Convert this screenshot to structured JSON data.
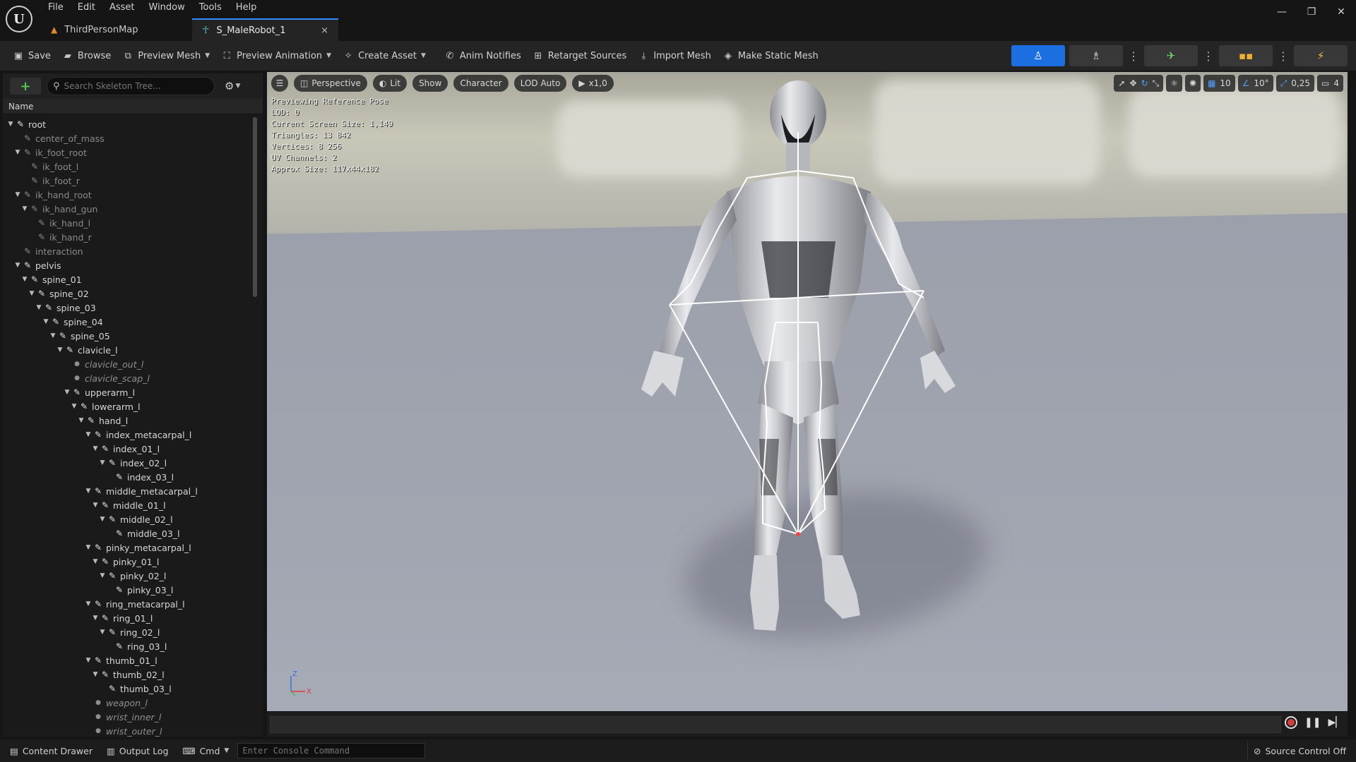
{
  "menu": [
    "File",
    "Edit",
    "Asset",
    "Window",
    "Tools",
    "Help"
  ],
  "tabs": [
    {
      "label": "ThirdPersonMap",
      "icon": "map-icon"
    },
    {
      "label": "S_MaleRobot_1",
      "icon": "skeleton-icon",
      "active": true,
      "close": "×"
    }
  ],
  "window_controls": {
    "minimize": "—",
    "restore": "❐",
    "close": "✕"
  },
  "toolbar": {
    "save": "Save",
    "browse": "Browse",
    "preview_mesh": "Preview Mesh",
    "preview_animation": "Preview Animation",
    "create_asset": "Create Asset",
    "anim_notifies": "Anim Notifies",
    "retarget_sources": "Retarget Sources",
    "import_mesh": "Import Mesh",
    "make_static_mesh": "Make Static Mesh"
  },
  "skeleton_tree": {
    "search_placeholder": "Search Skeleton Tree...",
    "column_name": "Name",
    "bones": [
      {
        "name": "root",
        "depth": 0,
        "arrow": true,
        "type": "bone"
      },
      {
        "name": "center_of_mass",
        "depth": 1,
        "arrow": false,
        "type": "dim"
      },
      {
        "name": "ik_foot_root",
        "depth": 1,
        "arrow": true,
        "type": "dim"
      },
      {
        "name": "ik_foot_l",
        "depth": 2,
        "arrow": false,
        "type": "dim"
      },
      {
        "name": "ik_foot_r",
        "depth": 2,
        "arrow": false,
        "type": "dim"
      },
      {
        "name": "ik_hand_root",
        "depth": 1,
        "arrow": true,
        "type": "dim"
      },
      {
        "name": "ik_hand_gun",
        "depth": 2,
        "arrow": true,
        "type": "dim"
      },
      {
        "name": "ik_hand_l",
        "depth": 3,
        "arrow": false,
        "type": "dim"
      },
      {
        "name": "ik_hand_r",
        "depth": 3,
        "arrow": false,
        "type": "dim"
      },
      {
        "name": "interaction",
        "depth": 1,
        "arrow": false,
        "type": "dim"
      },
      {
        "name": "pelvis",
        "depth": 1,
        "arrow": true,
        "type": "bone"
      },
      {
        "name": "spine_01",
        "depth": 2,
        "arrow": true,
        "type": "bone"
      },
      {
        "name": "spine_02",
        "depth": 3,
        "arrow": true,
        "type": "bone"
      },
      {
        "name": "spine_03",
        "depth": 4,
        "arrow": true,
        "type": "bone"
      },
      {
        "name": "spine_04",
        "depth": 5,
        "arrow": true,
        "type": "bone"
      },
      {
        "name": "spine_05",
        "depth": 6,
        "arrow": true,
        "type": "bone"
      },
      {
        "name": "clavicle_l",
        "depth": 7,
        "arrow": true,
        "type": "bone"
      },
      {
        "name": "clavicle_out_l",
        "depth": 8,
        "arrow": false,
        "type": "socket"
      },
      {
        "name": "clavicle_scap_l",
        "depth": 8,
        "arrow": false,
        "type": "socket"
      },
      {
        "name": "upperarm_l",
        "depth": 8,
        "arrow": true,
        "type": "bone"
      },
      {
        "name": "lowerarm_l",
        "depth": 9,
        "arrow": true,
        "type": "bone"
      },
      {
        "name": "hand_l",
        "depth": 10,
        "arrow": true,
        "type": "bone"
      },
      {
        "name": "index_metacarpal_l",
        "depth": 11,
        "arrow": true,
        "type": "bone"
      },
      {
        "name": "index_01_l",
        "depth": 12,
        "arrow": true,
        "type": "bone"
      },
      {
        "name": "index_02_l",
        "depth": 13,
        "arrow": true,
        "type": "bone"
      },
      {
        "name": "index_03_l",
        "depth": 14,
        "arrow": false,
        "type": "bone"
      },
      {
        "name": "middle_metacarpal_l",
        "depth": 11,
        "arrow": true,
        "type": "bone"
      },
      {
        "name": "middle_01_l",
        "depth": 12,
        "arrow": true,
        "type": "bone"
      },
      {
        "name": "middle_02_l",
        "depth": 13,
        "arrow": true,
        "type": "bone"
      },
      {
        "name": "middle_03_l",
        "depth": 14,
        "arrow": false,
        "type": "bone"
      },
      {
        "name": "pinky_metacarpal_l",
        "depth": 11,
        "arrow": true,
        "type": "bone"
      },
      {
        "name": "pinky_01_l",
        "depth": 12,
        "arrow": true,
        "type": "bone"
      },
      {
        "name": "pinky_02_l",
        "depth": 13,
        "arrow": true,
        "type": "bone"
      },
      {
        "name": "pinky_03_l",
        "depth": 14,
        "arrow": false,
        "type": "bone"
      },
      {
        "name": "ring_metacarpal_l",
        "depth": 11,
        "arrow": true,
        "type": "bone"
      },
      {
        "name": "ring_01_l",
        "depth": 12,
        "arrow": true,
        "type": "bone"
      },
      {
        "name": "ring_02_l",
        "depth": 13,
        "arrow": true,
        "type": "bone"
      },
      {
        "name": "ring_03_l",
        "depth": 14,
        "arrow": false,
        "type": "bone"
      },
      {
        "name": "thumb_01_l",
        "depth": 11,
        "arrow": true,
        "type": "bone"
      },
      {
        "name": "thumb_02_l",
        "depth": 12,
        "arrow": true,
        "type": "bone"
      },
      {
        "name": "thumb_03_l",
        "depth": 13,
        "arrow": false,
        "type": "bone"
      },
      {
        "name": "weapon_l",
        "depth": 11,
        "arrow": false,
        "type": "socket"
      },
      {
        "name": "wrist_inner_l",
        "depth": 11,
        "arrow": false,
        "type": "socket"
      },
      {
        "name": "wrist_outer_l",
        "depth": 11,
        "arrow": false,
        "type": "socket"
      }
    ]
  },
  "viewport": {
    "pills": {
      "perspective": "Perspective",
      "lit": "Lit",
      "show": "Show",
      "character": "Character",
      "lod": "LOD Auto",
      "speed": "x1,0"
    },
    "right": {
      "grid": "10",
      "angle": "10°",
      "scale": "0,25",
      "camera": "4"
    },
    "stats": [
      "Previewing Reference Pose",
      "LOD: 0",
      "Current Screen Size: 1,149",
      "Triangles: 13 842",
      "Vertices: 8 256",
      "UV Channels: 2",
      "Approx Size: 117x44x182"
    ],
    "axis": {
      "z": "Z",
      "x": "X"
    }
  },
  "statusbar": {
    "content_drawer": "Content Drawer",
    "output_log": "Output Log",
    "cmd": "Cmd",
    "console_placeholder": "Enter Console Command",
    "source_control": "Source Control Off"
  },
  "colors": {
    "accent": "#1b6fe0",
    "tab_highlight": "#2d8cff",
    "add_green": "#4fc84f"
  }
}
